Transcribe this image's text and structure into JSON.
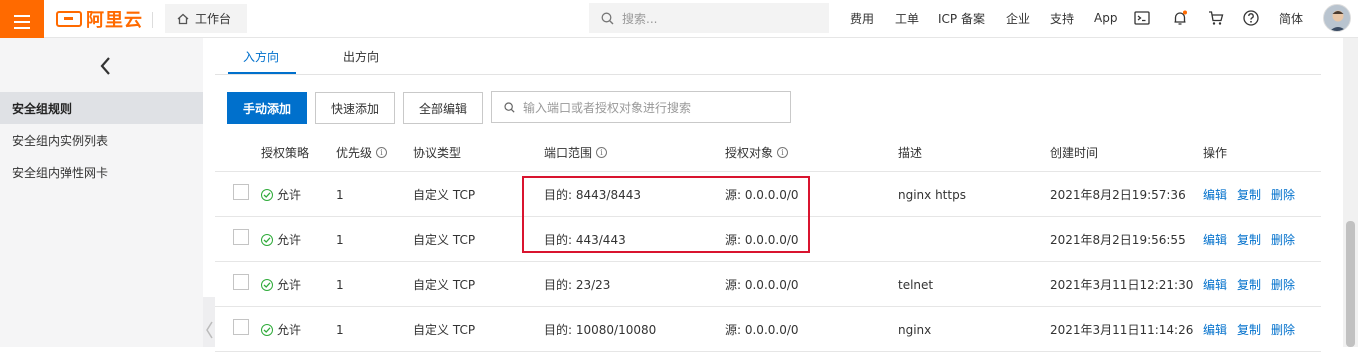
{
  "topbar": {
    "logo_text": "阿里云",
    "workbench_label": "工作台",
    "search_placeholder": "搜索...",
    "nav": [
      "费用",
      "工单",
      "ICP 备案",
      "企业",
      "支持",
      "App"
    ],
    "lang_label": "简体",
    "brand_color": "#ff6a00"
  },
  "sidebar": {
    "items": [
      {
        "label": "安全组规则",
        "active": true
      },
      {
        "label": "安全组内实例列表",
        "active": false
      },
      {
        "label": "安全组内弹性网卡",
        "active": false
      }
    ]
  },
  "main": {
    "tabs": [
      {
        "label": "入方向",
        "active": true
      },
      {
        "label": "出方向",
        "active": false
      }
    ],
    "toolbar": {
      "add_manual": "手动添加",
      "add_quick": "快速添加",
      "edit_all": "全部编辑",
      "filter_placeholder": "输入端口或者授权对象进行搜索"
    },
    "columns": [
      "授权策略",
      "优先级",
      "协议类型",
      "端口范围",
      "授权对象",
      "描述",
      "创建时间",
      "操作"
    ],
    "rows": [
      {
        "policy": "允许",
        "priority": "1",
        "protocol": "自定义 TCP",
        "port": "目的: 8443/8443",
        "source": "源: 0.0.0.0/0",
        "desc": "nginx https",
        "created": "2021年8月2日19:57:36"
      },
      {
        "policy": "允许",
        "priority": "1",
        "protocol": "自定义 TCP",
        "port": "目的: 443/443",
        "source": "源: 0.0.0.0/0",
        "desc": "",
        "created": "2021年8月2日19:56:55"
      },
      {
        "policy": "允许",
        "priority": "1",
        "protocol": "自定义 TCP",
        "port": "目的: 23/23",
        "source": "源: 0.0.0.0/0",
        "desc": "telnet",
        "created": "2021年3月11日12:21:30"
      },
      {
        "policy": "允许",
        "priority": "1",
        "protocol": "自定义 TCP",
        "port": "目的: 10080/10080",
        "source": "源: 0.0.0.0/0",
        "desc": "nginx",
        "created": "2021年3月11日11:14:26"
      }
    ],
    "actions": [
      "编辑",
      "复制",
      "删除"
    ],
    "accent_color": "#0070cc",
    "highlight_color": "#d9142f"
  }
}
